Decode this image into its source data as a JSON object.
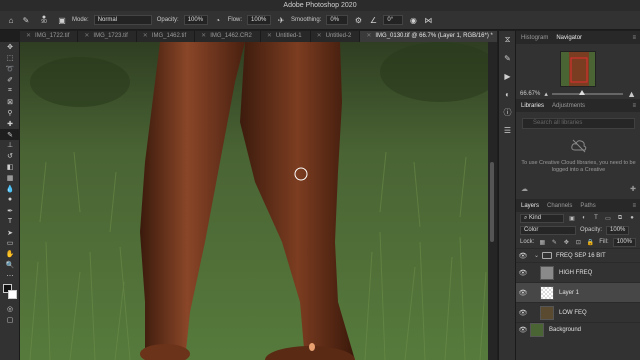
{
  "app": {
    "title": "Adobe Photoshop 2020"
  },
  "options_bar": {
    "brush_size": "90",
    "mode_label": "Mode:",
    "mode_value": "Normal",
    "opacity_label": "Opacity:",
    "opacity_value": "100%",
    "flow_label": "Flow:",
    "flow_value": "100%",
    "smoothing_label": "Smoothing:",
    "smoothing_value": "0%",
    "angle_value": "0°"
  },
  "document_tabs": [
    {
      "label": "IMG_1722.tif",
      "active": false
    },
    {
      "label": "IMG_1723.tif",
      "active": false
    },
    {
      "label": "IMG_1462.tif",
      "active": false
    },
    {
      "label": "IMG_1462.CR2",
      "active": false
    },
    {
      "label": "Untitled-1",
      "active": false
    },
    {
      "label": "Untitled-2",
      "active": false
    },
    {
      "label": "IMG_0130.tif @ 66.7% (Layer 1, RGB/16*) *",
      "active": true
    }
  ],
  "navigator_panel": {
    "tabs": [
      "Histogram",
      "Navigator"
    ],
    "active_tab": "Navigator",
    "zoom": "66.67%"
  },
  "libraries_panel": {
    "tabs": [
      "Libraries",
      "Adjustments"
    ],
    "active_tab": "Libraries",
    "search_placeholder": "Search all libraries",
    "message": "To use Creative Cloud libraries, you need to be logged into a Creative"
  },
  "layers_panel": {
    "tabs": [
      "Layers",
      "Channels",
      "Paths"
    ],
    "active_tab": "Layers",
    "kind_label": "Kind",
    "blend_mode": "Color",
    "opacity_label": "Opacity:",
    "opacity_value": "100%",
    "lock_label": "Lock:",
    "fill_label": "Fill:",
    "fill_value": "100%",
    "layers": [
      {
        "name": "FREQ SEP 16 BIT",
        "type": "group",
        "selected": false
      },
      {
        "name": "HIGH FREQ",
        "type": "layer",
        "selected": false
      },
      {
        "name": "Layer 1",
        "type": "layer",
        "selected": true
      },
      {
        "name": "LOW FEQ",
        "type": "layer",
        "selected": false
      },
      {
        "name": "Background",
        "type": "layer",
        "selected": false
      }
    ]
  },
  "colors": {
    "panel_bg": "#323232",
    "dark_bg": "#1e1e1e",
    "selected_layer": "#474747",
    "skin": "#7a3d22",
    "grass": "#4d6a32"
  }
}
